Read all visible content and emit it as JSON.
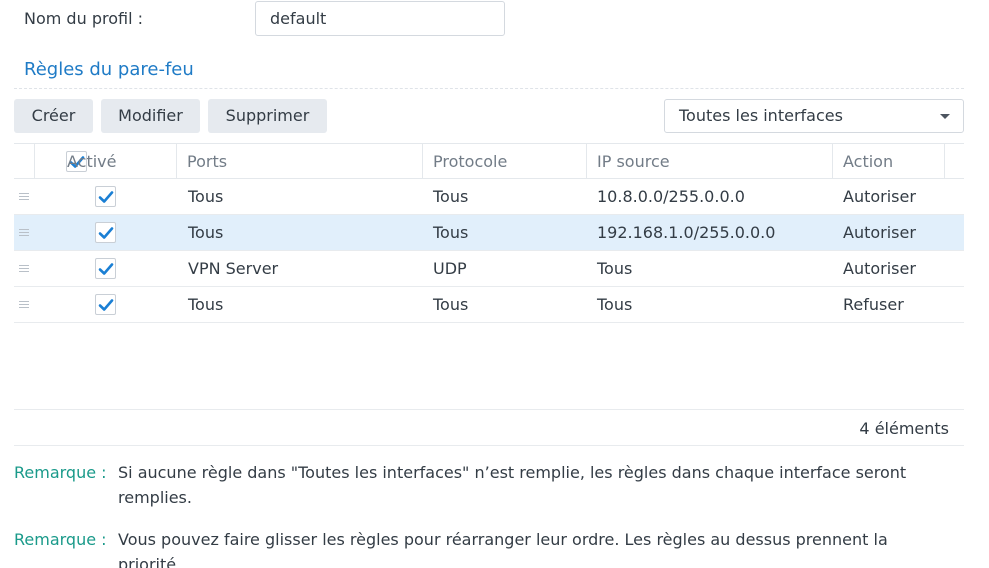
{
  "profile": {
    "label": "Nom du profil :",
    "value": "default"
  },
  "section": {
    "title": "Règles du pare-feu"
  },
  "toolbar": {
    "create_label": "Créer",
    "modify_label": "Modifier",
    "delete_label": "Supprimer"
  },
  "interface_select": {
    "value": "Toutes les interfaces",
    "icon": "chevron-down-icon"
  },
  "table": {
    "headers": {
      "active": "Activé",
      "ports": "Ports",
      "protocol": "Protocole",
      "ip_source": "IP source",
      "action": "Action"
    },
    "header_checked": true,
    "rows": [
      {
        "enabled": true,
        "ports": "Tous",
        "protocol": "Tous",
        "ip_source": "10.8.0.0/255.0.0.0",
        "action": "Autoriser",
        "selected": false
      },
      {
        "enabled": true,
        "ports": "Tous",
        "protocol": "Tous",
        "ip_source": "192.168.1.0/255.0.0.0",
        "action": "Autoriser",
        "selected": true
      },
      {
        "enabled": true,
        "ports": "VPN Server",
        "protocol": "UDP",
        "ip_source": "Tous",
        "action": "Autoriser",
        "selected": false
      },
      {
        "enabled": true,
        "ports": "Tous",
        "protocol": "Tous",
        "ip_source": "Tous",
        "action": "Refuser",
        "selected": false
      }
    ],
    "count_label": "4 éléments"
  },
  "notes": [
    {
      "label": "Remarque :",
      "text": "Si aucune règle dans \"Toutes les interfaces\" n’est remplie, les règles dans chaque interface seront remplies."
    },
    {
      "label": "Remarque :",
      "text": "Vous pouvez faire glisser les règles pour réarranger leur ordre. Les règles au dessus prennent la priorité."
    }
  ],
  "colors": {
    "accent": "#1f7bc6",
    "checkbox": "#1a7fd4",
    "selected_row": "#e1effb",
    "note_label": "#1a9a8a"
  }
}
